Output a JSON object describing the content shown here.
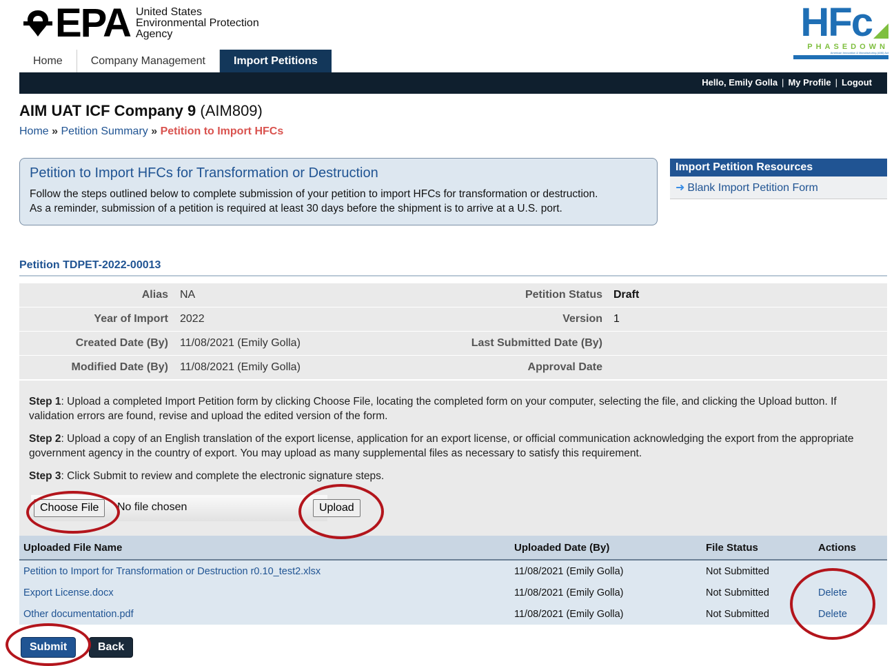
{
  "header": {
    "epa_mark": "EPA",
    "epa_line1": "United States",
    "epa_line2": "Environmental Protection",
    "epa_line3": "Agency",
    "hfc_mark": "HFc",
    "hfc_phase": "PHASEDOWN",
    "hfc_tagline": "American Innovation & Manufacturing (AIM) Act",
    "hfc_tagline2": "A U.S. Environmental Protection Agency Program"
  },
  "nav": {
    "tabs": [
      {
        "label": "Home",
        "active": false
      },
      {
        "label": "Company Management",
        "active": false
      },
      {
        "label": "Import Petitions",
        "active": true
      }
    ]
  },
  "topbar": {
    "greeting": "Hello, Emily Golla",
    "profile": "My Profile",
    "logout": "Logout",
    "separator": "|"
  },
  "company": {
    "name": "AIM UAT ICF Company 9",
    "code": "(AIM809)"
  },
  "breadcrumb": {
    "home": "Home",
    "sep": "»",
    "summary": "Petition Summary",
    "current": "Petition to Import HFCs"
  },
  "info": {
    "title": "Petition to Import HFCs for Transformation or Destruction",
    "line1": "Follow the steps outlined below to complete submission of your petition to import HFCs for transformation or destruction.",
    "line2": "As a reminder, submission of a petition is required at least 30 days before the shipment is to arrive at a U.S. port."
  },
  "resources": {
    "heading": "Import Petition Resources",
    "items": [
      {
        "label": "Blank Import Petition Form",
        "icon": "arrow-right-icon"
      }
    ]
  },
  "petition": {
    "title": "Petition TDPET-2022-00013",
    "rows": [
      {
        "label_l": "Alias",
        "value_l": "NA",
        "label_r": "Petition Status",
        "value_r": "Draft"
      },
      {
        "label_l": "Year of Import",
        "value_l": "2022",
        "label_r": "Version",
        "value_r": "1"
      },
      {
        "label_l": "Created Date (By)",
        "value_l": "11/08/2021  (Emily Golla)",
        "label_r": "Last Submitted Date (By)",
        "value_r": ""
      },
      {
        "label_l": "Modified Date (By)",
        "value_l": "11/08/2021  (Emily Golla)",
        "label_r": "Approval Date",
        "value_r": ""
      }
    ]
  },
  "steps": {
    "step1_label": "Step 1",
    "step1_text": ": Upload a completed Import Petition form by clicking Choose File, locating the completed form on your computer, selecting the file, and clicking the Upload button. If validation errors are found, revise and upload the edited version of the form.",
    "step2_label": "Step 2",
    "step2_text": ": Upload a copy of an English translation of the export license, application for an export license, or official communication acknowledging the export from the appropriate government agency in the country of export. You may upload as many supplemental files as necessary to satisfy this requirement.",
    "step3_label": "Step 3",
    "step3_text": ": Click Submit to review and complete the electronic signature steps."
  },
  "upload": {
    "choose_label": "Choose File",
    "no_file": "No file chosen",
    "upload_label": "Upload"
  },
  "files": {
    "headers": {
      "name": "Uploaded File Name",
      "date": "Uploaded Date (By)",
      "status": "File Status",
      "actions": "Actions"
    },
    "rows": [
      {
        "name": "Petition to Import for Transformation or Destruction r0.10_test2.xlsx",
        "date": "11/08/2021  (Emily Golla)",
        "status": "Not Submitted",
        "action": ""
      },
      {
        "name": "Export License.docx",
        "date": "11/08/2021  (Emily Golla)",
        "status": "Not Submitted",
        "action": "Delete"
      },
      {
        "name": "Other documentation.pdf",
        "date": "11/08/2021  (Emily Golla)",
        "status": "Not Submitted",
        "action": "Delete"
      }
    ]
  },
  "buttons": {
    "submit": "Submit",
    "back": "Back"
  },
  "colors": {
    "nav_active": "#13375a",
    "topbar": "#0f1f2e",
    "link": "#205493",
    "breadcrumb_current": "#d9534f",
    "annotation_circle": "#b3151c"
  }
}
